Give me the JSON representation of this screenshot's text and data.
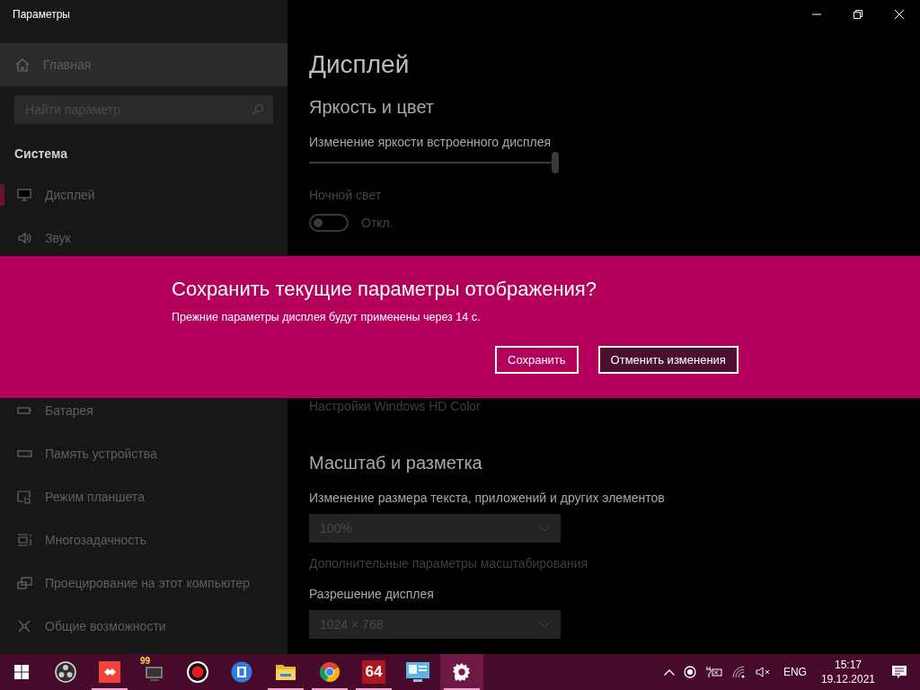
{
  "window": {
    "title": "Параметры"
  },
  "sidebar": {
    "home": "Главная",
    "search": {
      "placeholder": "Найти параметр"
    },
    "section": "Система",
    "items": [
      {
        "label": "Дисплей",
        "selected": true
      },
      {
        "label": "Звук",
        "selected": false
      },
      {
        "label": "Батарея",
        "selected": false
      },
      {
        "label": "Память устройства",
        "selected": false
      },
      {
        "label": "Режим планшета",
        "selected": false
      },
      {
        "label": "Многозадачность",
        "selected": false
      },
      {
        "label": "Проецирование на этот компьютер",
        "selected": false
      },
      {
        "label": "Общие возможности",
        "selected": false
      }
    ]
  },
  "content": {
    "title": "Дисплей",
    "brightness": {
      "heading": "Яркость и цвет",
      "label": "Изменение яркости встроенного дисплея",
      "level": 1.0
    },
    "night_light": {
      "label": "Ночной свет",
      "on": false,
      "state": "Откл."
    },
    "hd_color_link": "Настройки Windows HD Color",
    "scale": {
      "heading": "Масштаб и разметка",
      "label": "Изменение размера текста, приложений и других элементов",
      "value": "100%",
      "link": "Дополнительные параметры масштабирования"
    },
    "resolution": {
      "label": "Разрешение дисплея",
      "value": "1024 × 768"
    }
  },
  "dialog": {
    "title": "Сохранить текущие параметры отображения?",
    "message": "Прежние параметры дисплея будут применены через 14 с.",
    "buttons": [
      {
        "label": "Сохранить",
        "default": false
      },
      {
        "label": "Отменить изменения",
        "default": true
      }
    ]
  },
  "taskbar": {
    "apps": [
      {
        "running": false,
        "active": false
      },
      {
        "running": true,
        "active": false
      },
      {
        "running": false,
        "active": false,
        "label": "99"
      },
      {
        "running": false,
        "active": false
      },
      {
        "running": false,
        "active": false
      },
      {
        "running": true,
        "active": false
      },
      {
        "running": true,
        "active": false
      },
      {
        "running": true,
        "active": false,
        "label": "64"
      },
      {
        "running": false,
        "active": false
      },
      {
        "running": true,
        "active": true
      }
    ],
    "language": "ENG",
    "time": "15:17",
    "date": "19.12.2021"
  }
}
